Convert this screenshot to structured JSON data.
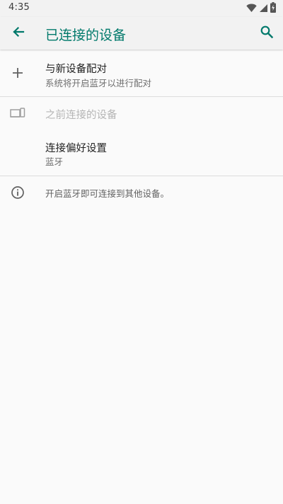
{
  "status_bar": {
    "time": "4:35",
    "icons": [
      "wifi-icon",
      "signal-icon",
      "battery-icon"
    ]
  },
  "app_bar": {
    "title": "已连接的设备",
    "back_icon": "arrow-back-icon",
    "search_icon": "search-icon"
  },
  "list": {
    "pair_new": {
      "icon": "plus-icon",
      "title": "与新设备配对",
      "subtitle": "系统将开启蓝牙以进行配对"
    },
    "previous_devices": {
      "icon": "devices-icon",
      "title": "之前连接的设备"
    },
    "connection_prefs": {
      "title": "连接偏好设置",
      "subtitle": "蓝牙"
    },
    "info": {
      "icon": "info-icon",
      "text": "开启蓝牙即可连接到其他设备。"
    }
  },
  "colors": {
    "accent": "#00796b",
    "background": "#fafafa",
    "appbar": "#f2f2f2",
    "text_primary": "#212121",
    "text_secondary": "#6f6f6f",
    "disabled": "#b5b5b5"
  }
}
